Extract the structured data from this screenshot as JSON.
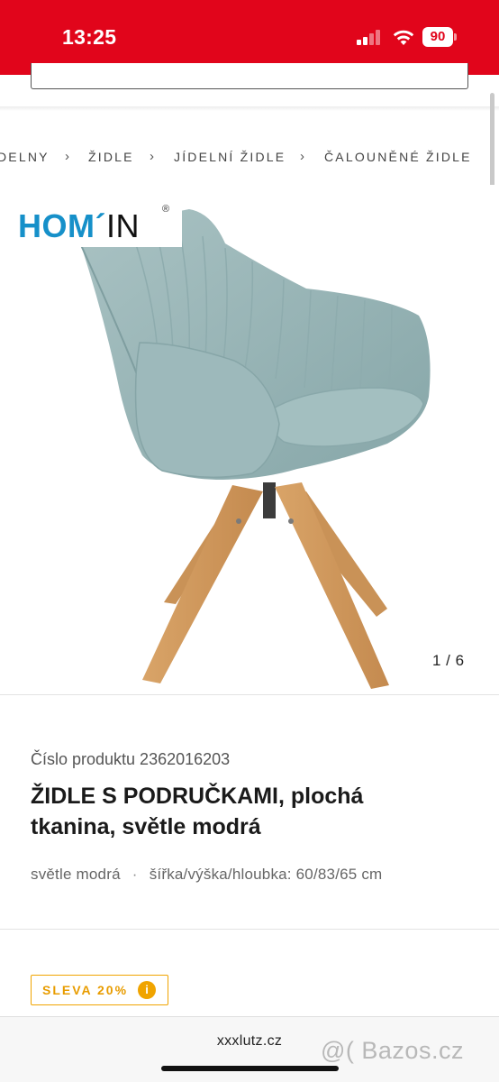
{
  "status_bar": {
    "time": "13:25",
    "battery": "90",
    "signal_icon": "cellular-signal-icon",
    "wifi_icon": "wifi-icon"
  },
  "breadcrumb": {
    "items": [
      "DELNY",
      "ŽIDLE",
      "JÍDELNÍ ŽIDLE",
      "ČALOUNĚNÉ ŽIDLE"
    ],
    "separator": "›"
  },
  "gallery": {
    "brand_hom": "HOM´",
    "brand_in": "IN",
    "brand_reg": "®",
    "counter": "1 / 6"
  },
  "product": {
    "number": "Číslo produktu 2362016203",
    "title_bold": "ŽIDLE",
    "title_rest": " S PODRUČKAMI, plochá tkanina, světle modrá",
    "color": "světle modrá",
    "meta_separator": "·",
    "dimensions": "šířka/výška/hloubka: 60/83/65 cm"
  },
  "discount": {
    "label": "SLEVA 20%",
    "icon": "i"
  },
  "browser": {
    "url": "xxxlutz.cz"
  },
  "watermark": "@( Bazos.cz",
  "colors": {
    "brand_red": "#e1051b",
    "brand_blue": "#1690c9",
    "discount_orange": "#f0a400"
  }
}
